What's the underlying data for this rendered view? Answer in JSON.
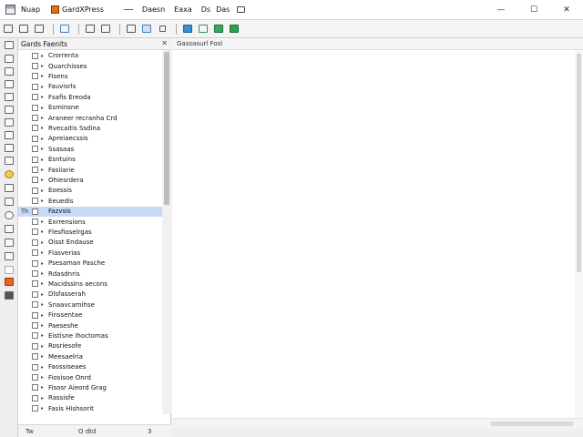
{
  "titlebar": {
    "app_title": "Nuap",
    "doc_title": "GardXPress",
    "menu_label": "Daesn",
    "tab_label_1": "Eaxa",
    "tab_label_2": "Ds",
    "tab_label_3": "Das",
    "minimize": "—",
    "maximize": "☐",
    "close": "✕"
  },
  "toolbar": {
    "buttons": [
      "open-icon",
      "save-icon",
      "print-icon",
      "cut-icon",
      "copy-icon",
      "paste-icon",
      "undo-icon",
      "redo-icon",
      "bookmark-icon",
      "image-icon",
      "folder-icon",
      "export-icon",
      "run-icon"
    ]
  },
  "panel": {
    "title": "Gards Faenits",
    "close": "✕",
    "footer_left": "Tw",
    "footer_mid": "O dtd",
    "footer_right": "3"
  },
  "tree": {
    "selected_prefix": "Th",
    "items": [
      "Crorrenta",
      "Quarchisses",
      "Fisens",
      "Fauvisrls",
      "Fsafis Ereoda",
      "Esminsne",
      "Araneer recranha Crd",
      "Rvecaitis Ssdina",
      "Apreiaecssis",
      "Ssasaas",
      "Esntuins",
      "Fasiiarie",
      "Ohiesrdera",
      "Eoessis",
      "Eeuedis",
      "Fazvsis",
      "Exrrensions",
      "Flesfioselrgas",
      "Oisst Endause",
      "Flasverias",
      "Psesaman Pasche",
      "Rdasdnris",
      "Macidssins aecons",
      "Dlsfasserah",
      "Snaavcamihse",
      "Finssentae",
      "Paeseshe",
      "Eistisne Ihoctomas",
      "Rosriesofe",
      "Meesaelria",
      "Faossiseaes",
      "Fiosisoe Onrd",
      "Fisosr Aieord Grag",
      "Rassisfe",
      "Fasis Hishsorit"
    ]
  },
  "main": {
    "tab_label": "Gassasurl Fosl"
  }
}
